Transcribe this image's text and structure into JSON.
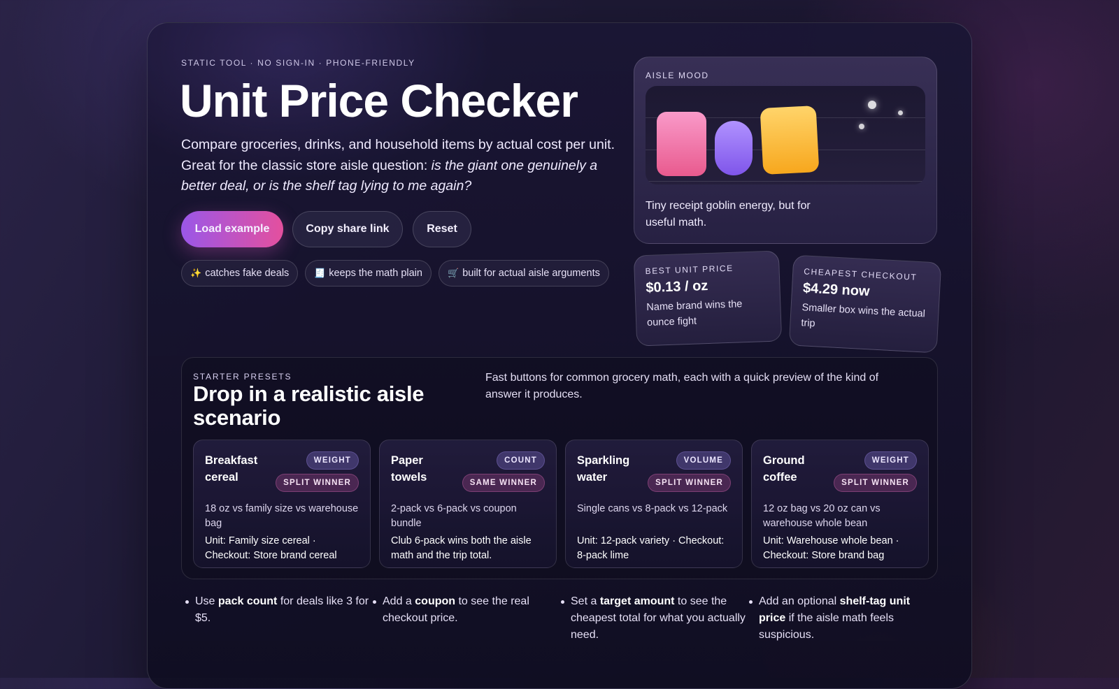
{
  "hero": {
    "eyebrow": "STATIC TOOL · NO SIGN-IN · PHONE-FRIENDLY",
    "title": "Unit Price Checker",
    "intro_plain": "Compare groceries, drinks, and household items by actual cost per unit. Great for the classic store aisle question: ",
    "intro_italic": "is the giant one genuinely a better deal, or is the shelf tag lying to me again?"
  },
  "actions": {
    "load_example": "Load example",
    "copy_share_link": "Copy share link",
    "reset": "Reset"
  },
  "chips": [
    {
      "icon": "✨",
      "label": "catches fake deals"
    },
    {
      "icon": "🧾",
      "label": "keeps the math plain"
    },
    {
      "icon": "🛒",
      "label": "built for actual aisle arguments"
    }
  ],
  "mood": {
    "label": "AISLE MOOD",
    "caption": "Tiny receipt goblin energy, but for useful math."
  },
  "stats": [
    {
      "label": "BEST UNIT PRICE",
      "value": "$0.13 / oz",
      "sub": "Name brand wins the ounce fight"
    },
    {
      "label": "CHEAPEST CHECKOUT",
      "value": "$4.29 now",
      "sub": "Smaller box wins the actual trip"
    }
  ],
  "presets": {
    "eyebrow": "STARTER PRESETS",
    "title": "Drop in a realistic aisle scenario",
    "description": "Fast buttons for common grocery math, each with a quick preview of the kind of answer it produces.",
    "cards": [
      {
        "name": "Breakfast cereal",
        "kind": "WEIGHT",
        "winner": "SPLIT WINNER",
        "desc": "18 oz vs family size vs warehouse bag",
        "result": "Unit: Family size cereal · Checkout: Store brand cereal"
      },
      {
        "name": "Paper towels",
        "kind": "COUNT",
        "winner": "SAME WINNER",
        "desc": "2-pack vs 6-pack vs coupon bundle",
        "result": "Club 6-pack wins both the aisle math and the trip total."
      },
      {
        "name": "Sparkling water",
        "kind": "VOLUME",
        "winner": "SPLIT WINNER",
        "desc": "Single cans vs 8-pack vs 12-pack",
        "result": "Unit: 12-pack variety · Checkout: 8-pack lime"
      },
      {
        "name": "Ground coffee",
        "kind": "WEIGHT",
        "winner": "SPLIT WINNER",
        "desc": "12 oz bag vs 20 oz can vs warehouse whole bean",
        "result": "Unit: Warehouse whole bean · Checkout: Store brand bag"
      }
    ]
  },
  "tips": [
    {
      "pre": "Use ",
      "bold": "pack count",
      "post": " for deals like 3 for $5."
    },
    {
      "pre": "Add a ",
      "bold": "coupon",
      "post": " to see the real checkout price."
    },
    {
      "pre": "Set a ",
      "bold": "target amount",
      "post": " to see the cheapest total for what you actually need."
    },
    {
      "pre": "Add an optional ",
      "bold": "shelf-tag unit price",
      "post": " if the aisle math feels suspicious."
    }
  ]
}
